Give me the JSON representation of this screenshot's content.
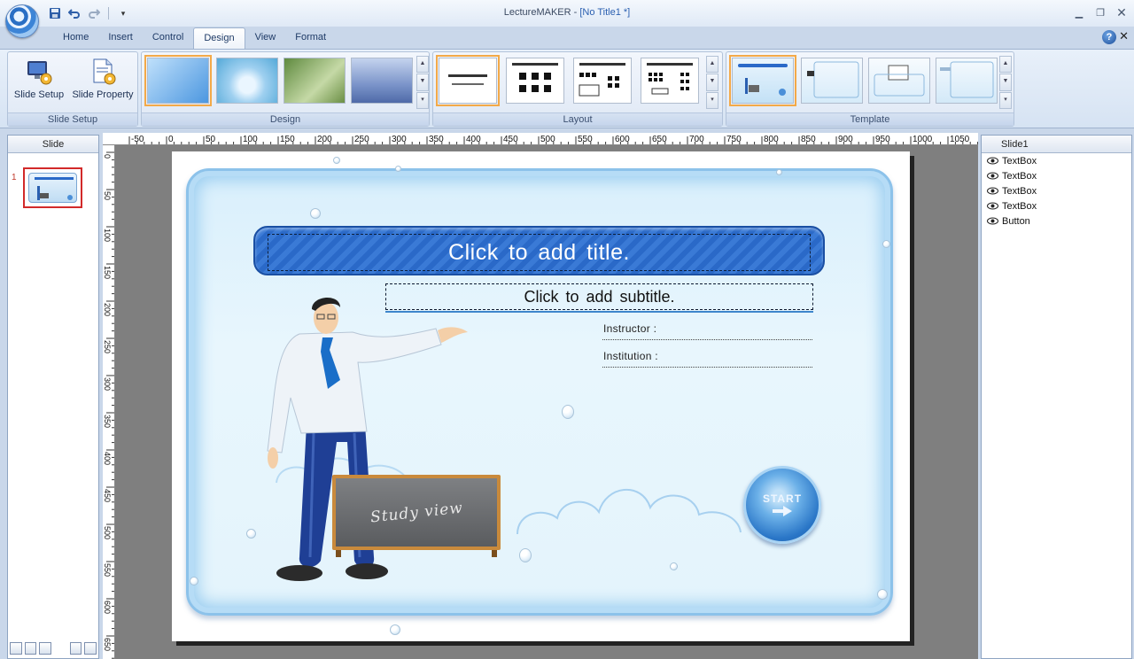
{
  "window": {
    "app_name": "LectureMAKER - ",
    "doc_name": "[No Title1 *]"
  },
  "tabs": [
    "Home",
    "Insert",
    "Control",
    "Design",
    "View",
    "Format"
  ],
  "active_tab": "Design",
  "ribbon": {
    "slide_setup_group": {
      "label": "Slide Setup",
      "buttons": [
        "Slide Setup",
        "Slide Property"
      ]
    },
    "design_group": {
      "label": "Design"
    },
    "layout_group": {
      "label": "Layout"
    },
    "template_group": {
      "label": "Template"
    }
  },
  "slide_panel": {
    "header": "Slide",
    "slide_number": "1"
  },
  "slide": {
    "title": "Click to add title.",
    "subtitle": "Click to add subtitle.",
    "instructor_label": "Instructor :",
    "institution_label": "Institution :",
    "board_text": "Study view",
    "start_label": "START"
  },
  "tree": {
    "root": "Slide1",
    "items": [
      "TextBox",
      "TextBox",
      "TextBox",
      "TextBox",
      "Button"
    ]
  },
  "ruler_h_labels": [
    "-50",
    "0",
    "50",
    "100",
    "150",
    "200",
    "250",
    "300",
    "350",
    "400",
    "450",
    "500",
    "550",
    "600",
    "650",
    "700",
    "750",
    "800",
    "850",
    "900",
    "950",
    "1000",
    "1050"
  ],
  "ruler_v_labels": [
    "0",
    "50",
    "100",
    "150",
    "200",
    "250",
    "300",
    "350",
    "400",
    "450",
    "500",
    "550",
    "600",
    "650"
  ],
  "colors": {
    "title_bar": "#2a69c8",
    "selection": "#f3a948",
    "thumb_border": "#d22a2a"
  }
}
